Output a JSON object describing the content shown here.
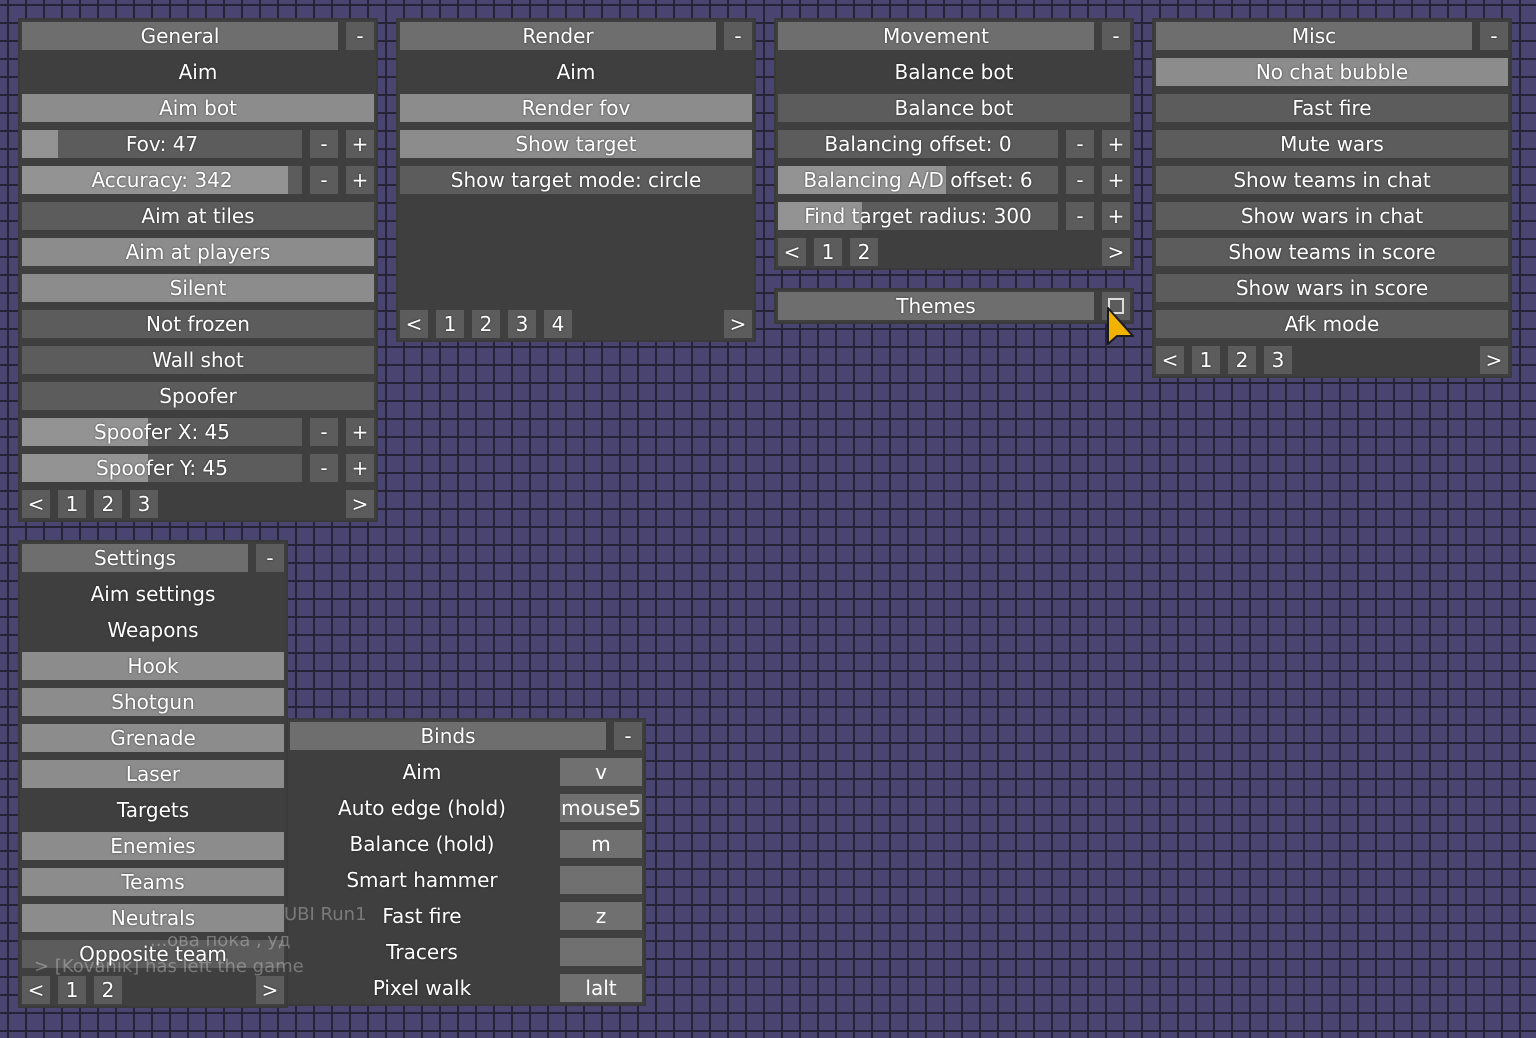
{
  "general": {
    "title": "General",
    "collapse": "-",
    "section": "Aim",
    "aim_bot": "Aim bot",
    "fov": {
      "label": "Fov: 47",
      "value": 47
    },
    "accuracy": {
      "label": "Accuracy: 342",
      "value": 342
    },
    "aim_at_tiles": "Aim at tiles",
    "aim_at_players": "Aim at players",
    "silent": "Silent",
    "not_frozen": "Not frozen",
    "wall_shot": "Wall shot",
    "spoofer": "Spoofer",
    "spoofer_x": {
      "label": "Spoofer X: 45",
      "value": 45
    },
    "spoofer_y": {
      "label": "Spoofer Y: 45",
      "value": 45
    },
    "minus": "-",
    "plus": "+",
    "pager": {
      "prev": "<",
      "p1": "1",
      "p2": "2",
      "p3": "3",
      "next": ">"
    }
  },
  "render": {
    "title": "Render",
    "collapse": "-",
    "section": "Aim",
    "render_fov": "Render fov",
    "show_target": "Show target",
    "show_target_mode": "Show target mode: circle",
    "pager": {
      "prev": "<",
      "p1": "1",
      "p2": "2",
      "p3": "3",
      "p4": "4",
      "next": ">"
    }
  },
  "movement": {
    "title": "Movement",
    "collapse": "-",
    "section": "Balance bot",
    "balance_bot": "Balance bot",
    "balancing_offset": {
      "label": "Balancing offset: 0",
      "value": 0
    },
    "balancing_ad_offset": {
      "label": "Balancing A/D offset: 6",
      "value": 6
    },
    "find_target_radius": {
      "label": "Find target radius: 300",
      "value": 300
    },
    "minus": "-",
    "plus": "+",
    "pager": {
      "prev": "<",
      "p1": "1",
      "p2": "2",
      "next": ">"
    }
  },
  "themes": {
    "title": "Themes"
  },
  "misc": {
    "title": "Misc",
    "collapse": "-",
    "items": [
      "No chat bubble",
      "Fast fire",
      "Mute wars",
      "Show teams in chat",
      "Show wars in chat",
      "Show teams in score",
      "Show wars in score",
      "Afk mode"
    ],
    "pager": {
      "prev": "<",
      "p1": "1",
      "p2": "2",
      "p3": "3",
      "next": ">"
    }
  },
  "settings": {
    "title": "Settings",
    "collapse": "-",
    "aim_settings": "Aim settings",
    "weapons_section": "Weapons",
    "hook": "Hook",
    "shotgun": "Shotgun",
    "grenade": "Grenade",
    "laser": "Laser",
    "targets_section": "Targets",
    "enemies": "Enemies",
    "teams": "Teams",
    "neutrals": "Neutrals",
    "opposite_team": "Opposite team",
    "pager": {
      "prev": "<",
      "p1": "1",
      "p2": "2",
      "next": ">"
    }
  },
  "binds": {
    "title": "Binds",
    "collapse": "-",
    "items": [
      {
        "label": "Aim",
        "key": "v"
      },
      {
        "label": "Auto edge (hold)",
        "key": "mouse5"
      },
      {
        "label": "Balance (hold)",
        "key": "m"
      },
      {
        "label": "Smart hammer",
        "key": ""
      },
      {
        "label": "Fast fire",
        "key": "z"
      },
      {
        "label": "Tracers",
        "key": ""
      },
      {
        "label": "Pixel walk",
        "key": "lalt"
      }
    ]
  },
  "chat_ghost": {
    "line1": "UBI Run1",
    "line2": "...ова пока , уд",
    "line3": "> [Kovanik] has left the game"
  },
  "colors": {
    "background": "#4a4470",
    "grid": "#262337",
    "panel": "#3f3f3f",
    "enabled": "#8c8c8c",
    "disabled": "#5c5c5c",
    "cursor": "#f2b300"
  }
}
